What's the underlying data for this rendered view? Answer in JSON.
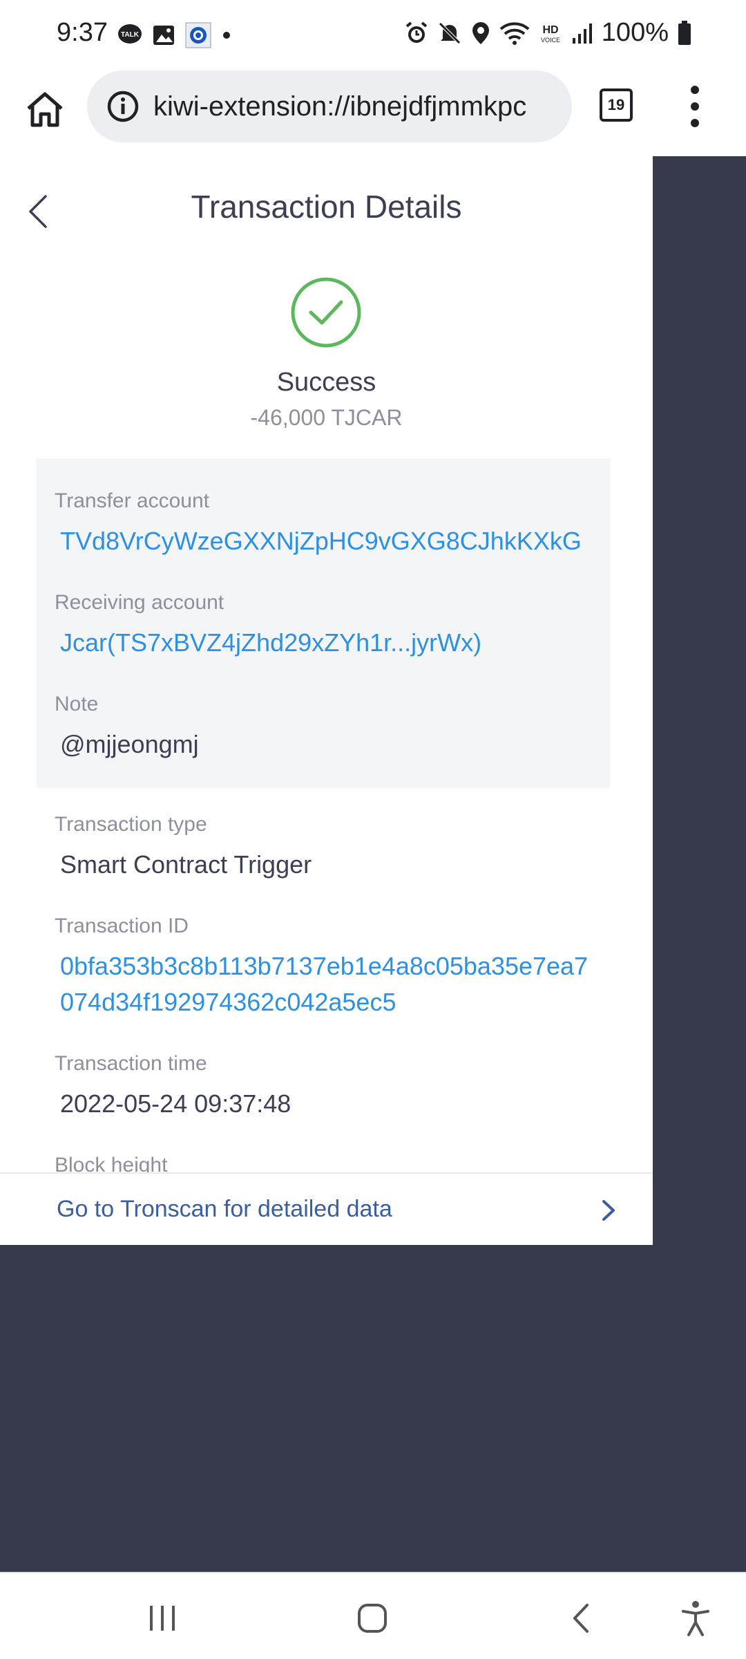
{
  "status_bar": {
    "time": "9:37",
    "left_icons": [
      "talk-icon",
      "image-icon",
      "app-icon",
      "dot-icon"
    ],
    "right_icons": [
      "alarm-icon",
      "mute-icon",
      "location-icon",
      "wifi-icon",
      "hd-voice-icon",
      "signal-icon",
      "battery-icon"
    ],
    "battery": "100%"
  },
  "browser": {
    "url": "kiwi-extension://ibnejdfjmmkpc",
    "tab_count": "19"
  },
  "page": {
    "title": "Transaction Details",
    "status": "Success",
    "amount": "-46,000 TJCAR",
    "status_color": "#5cb85c"
  },
  "details": {
    "transfer_account_label": "Transfer account",
    "transfer_account": "TVd8VrCyWzeGXXNjZpHC9vGXG8CJhkKXkG",
    "receiving_account_label": "Receiving account",
    "receiving_account": "Jcar(TS7xBVZ4jZhd29xZYh1r...jyrWx)",
    "note_label": "Note",
    "note": "@mjjeongmj",
    "transaction_type_label": "Transaction type",
    "transaction_type": "Smart Contract Trigger",
    "transaction_id_label": "Transaction ID",
    "transaction_id_line1": "0bfa353b3c8b113b7137eb1e4a8c05ba35e7ea7",
    "transaction_id_line2": "074d34f192974362c042a5ec5",
    "transaction_time_label": "Transaction time",
    "transaction_time": "2022-05-24 09:37:48",
    "block_height_label": "Block height"
  },
  "footer": {
    "link_label": "Go to Tronscan for detailed data"
  }
}
